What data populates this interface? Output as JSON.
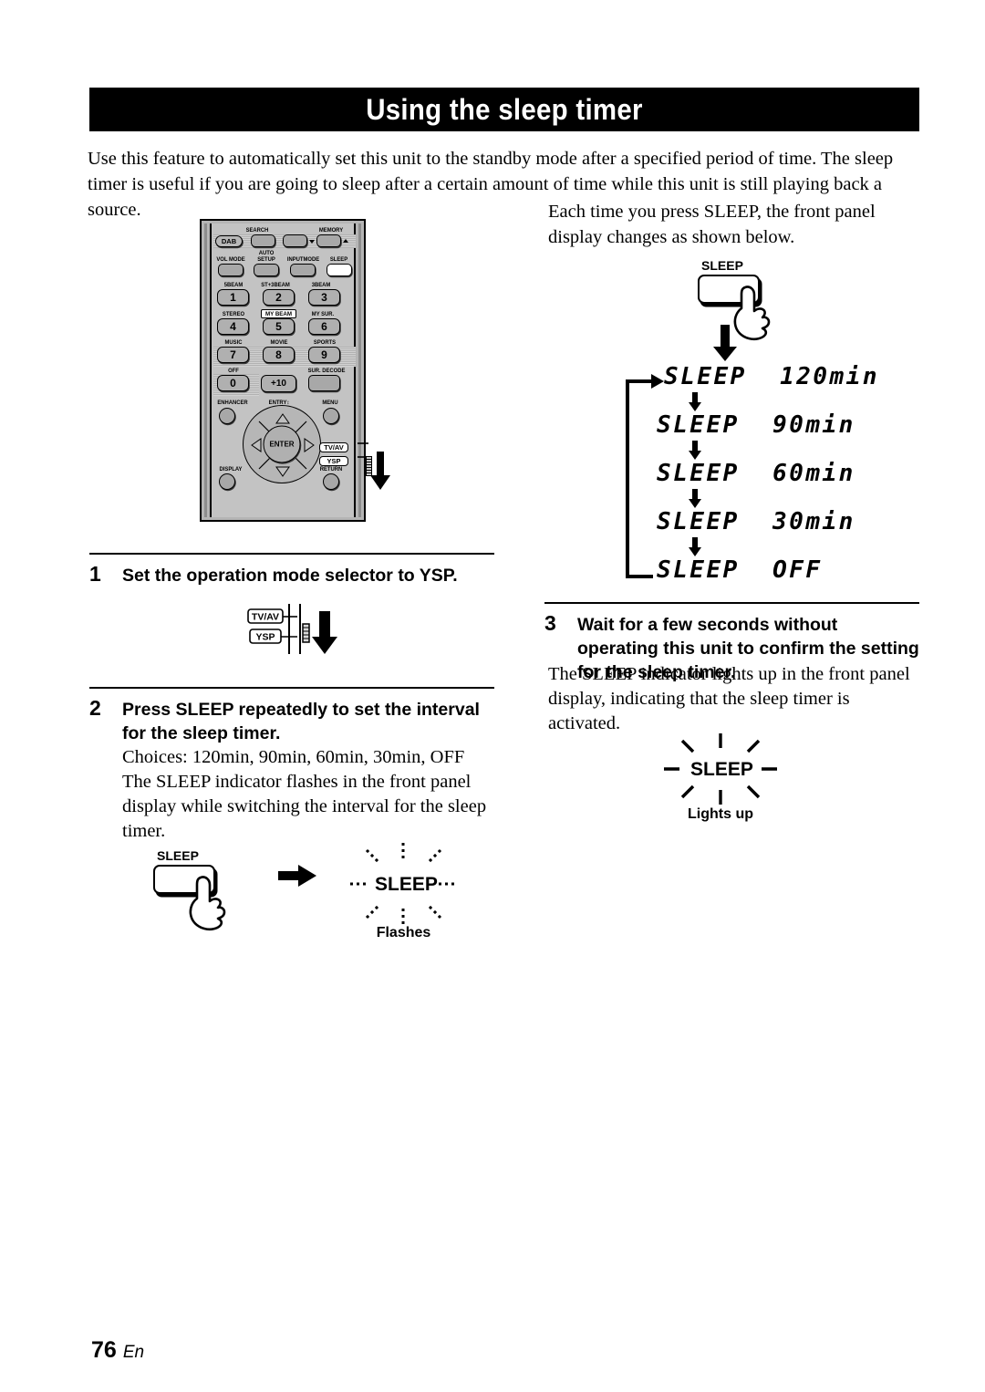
{
  "page": {
    "title": "Using the sleep timer",
    "intro": "Use this feature to automatically set this unit to the standby mode after a specified period of time. The sleep timer is useful if you are going to sleep after a certain amount of time while this unit is still playing back a source.",
    "footer_number": "76",
    "footer_lang": "En"
  },
  "right_column": {
    "intro": "Each time you press SLEEP, the front panel display changes as shown below."
  },
  "remote": {
    "buttons": {
      "dab": "DAB",
      "search": "SEARCH",
      "memory": "MEMORY",
      "vol_mode": "VOL MODE",
      "auto_setup_line1": "AUTO",
      "auto_setup_line2": "SETUP",
      "input_mode": "INPUTMODE",
      "sleep": "SLEEP",
      "beam5": "5BEAM",
      "st3beam": "ST+3BEAM",
      "beam3": "3BEAM",
      "stereo": "STEREO",
      "my_beam": "MY BEAM",
      "my_sur": "MY SUR.",
      "music": "MUSIC",
      "movie": "MOVIE",
      "sports": "SPORTS",
      "off": "OFF",
      "sur_decode": "SUR. DECODE",
      "enhancer": "ENHANCER",
      "entry": "ENTRY",
      "menu": "MENU",
      "display": "DISPLAY",
      "return": "RETURN",
      "enter": "ENTER",
      "num1": "1",
      "num2": "2",
      "num3": "3",
      "num4": "4",
      "num5": "5",
      "num6": "6",
      "num7": "7",
      "num8": "8",
      "num9": "9",
      "num0": "0",
      "plus10": "+10",
      "tv_av": "TV/AV",
      "ysp": "YSP"
    }
  },
  "steps": [
    {
      "number": "1",
      "title": "Set the operation mode selector to YSP.",
      "body": ""
    },
    {
      "number": "2",
      "title": "Press SLEEP repeatedly to set the interval for the sleep timer.",
      "body": "Choices: 120min, 90min, 60min, 30min, OFF\nThe SLEEP indicator flashes in the front panel display while switching the interval for the sleep timer."
    },
    {
      "number": "3",
      "title": "Wait for a few seconds without operating this unit to confirm the setting for the sleep timer.",
      "body": "The SLEEP indicator lights up in the front panel display, indicating that the sleep timer is activated."
    }
  ],
  "mode_selector": {
    "top_label": "TV/AV",
    "bottom_label": "YSP"
  },
  "sleep_button_figure": {
    "label": "SLEEP"
  },
  "display_flow": {
    "items": [
      "SLEEP  120min",
      "SLEEP  90min",
      "SLEEP  60min",
      "SLEEP  30min",
      "SLEEP  OFF"
    ]
  },
  "indicator_flashes": {
    "button_label": "SLEEP",
    "indicator_label": "SLEEP",
    "caption": "Flashes"
  },
  "indicator_lights_up": {
    "indicator_label": "SLEEP",
    "caption": "Lights up"
  },
  "colors": {
    "header_bg": "#000000",
    "header_text": "#ffffff",
    "remote_body": "#b5b5b5",
    "remote_face": "#c3c3c3",
    "button_face": "#a8a8a8",
    "highlight": "#ffffff"
  }
}
